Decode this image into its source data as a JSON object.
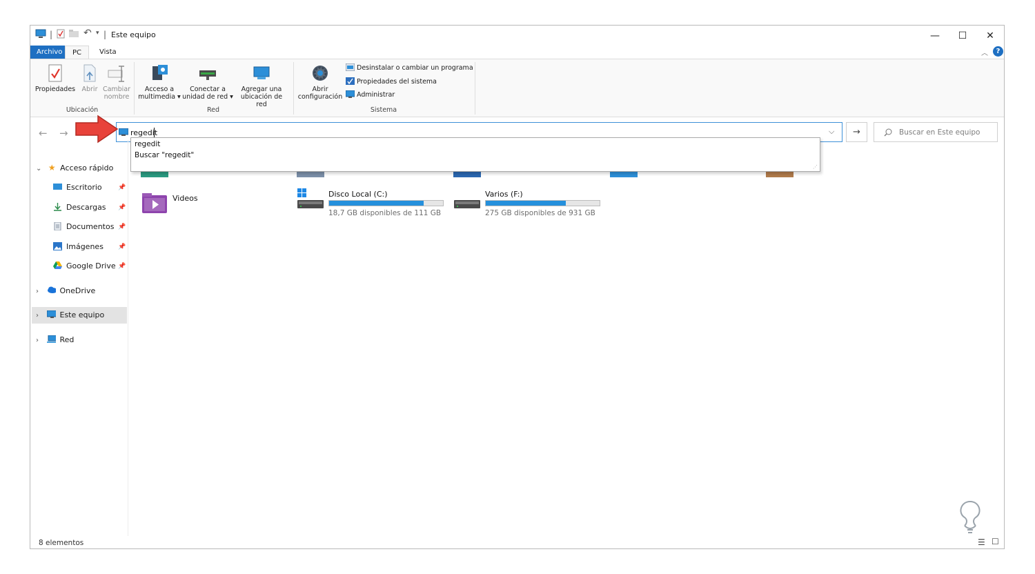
{
  "window": {
    "title": "Este equipo",
    "controls": {
      "minimize": "—",
      "maximize": "☐",
      "close": "✕"
    }
  },
  "tabs": {
    "file": "Archivo",
    "pc": "PC",
    "view": "Vista"
  },
  "ribbon": {
    "ubicacion": {
      "label": "Ubicación",
      "propiedades": "Propiedades",
      "abrir": "Abrir",
      "cambiar_line1": "Cambiar",
      "cambiar_line2": "nombre"
    },
    "red": {
      "label": "Red",
      "multimedia_line1": "Acceso a",
      "multimedia_line2": "multimedia ▾",
      "conectar_line1": "Conectar a",
      "conectar_line2": "unidad de red ▾",
      "agregar_line1": "Agregar una",
      "agregar_line2": "ubicación de red"
    },
    "sistema": {
      "label": "Sistema",
      "abrir_line1": "Abrir",
      "abrir_line2": "configuración",
      "desinstalar": "Desinstalar o cambiar un programa",
      "propiedades_sistema": "Propiedades del sistema",
      "administrar": "Administrar"
    }
  },
  "address": {
    "value": "regedit",
    "suggestions": [
      "regedit",
      "Buscar \"regedit\""
    ]
  },
  "search": {
    "placeholder": "Buscar en Este equipo"
  },
  "sidebar": {
    "quick_access": "Acceso rápido",
    "items": [
      "Escritorio",
      "Descargas",
      "Documentos",
      "Imágenes",
      "Google Drive"
    ],
    "onedrive": "OneDrive",
    "this_pc": "Este equipo",
    "network": "Red"
  },
  "content": {
    "videos": "Videos",
    "drives": [
      {
        "name": "Disco Local (C:)",
        "free": "18,7 GB disponibles de 111 GB",
        "used_fraction": 0.83
      },
      {
        "name": "Varios (F:)",
        "free": "275 GB disponibles de 931 GB",
        "used_fraction": 0.7
      }
    ]
  },
  "status": {
    "count": "8 elementos"
  },
  "colors": {
    "accent": "#1e6fc2",
    "drive_bar": "#2590dc",
    "arrow": "#e8423a"
  }
}
